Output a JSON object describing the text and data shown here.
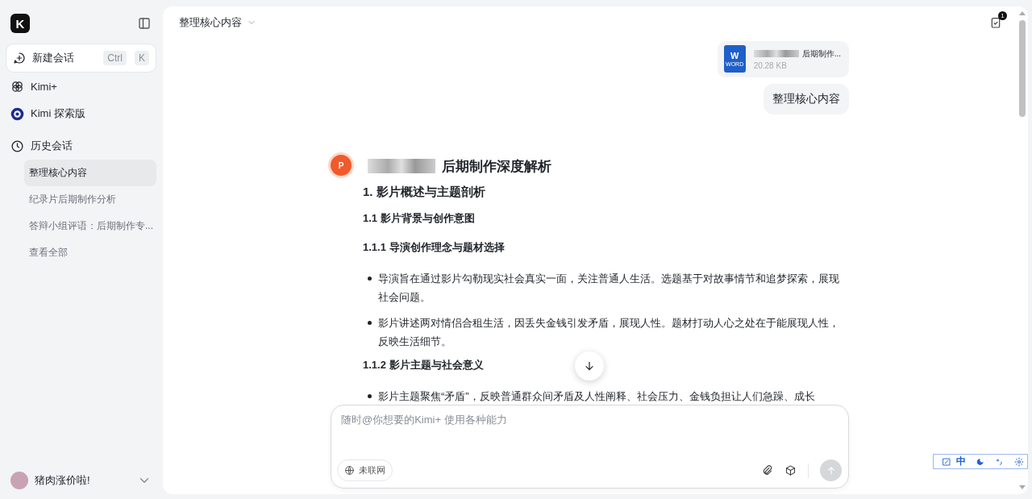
{
  "sidebar": {
    "logo": "K",
    "new_chat": {
      "label": "新建会话",
      "shortcut": [
        "Ctrl",
        "K"
      ]
    },
    "nav": [
      {
        "label": "Kimi+",
        "kind": "kimiplus"
      },
      {
        "label": "Kimi 探索版",
        "kind": "explore"
      }
    ],
    "history": {
      "label": "历史会话",
      "items": [
        {
          "label": "整理核心内容",
          "selected": true
        },
        {
          "label": "纪录片后期制作分析",
          "selected": false
        },
        {
          "label": "答辩小组评语：后期制作专...",
          "selected": false
        }
      ],
      "view_all": "查看全部"
    },
    "user": {
      "name": "猪肉涨价啦!"
    }
  },
  "header": {
    "title": "整理核心内容",
    "badge": "1"
  },
  "messages": [
    {
      "kind": "file",
      "icon_letter": "W",
      "icon_label": "WORD",
      "name": "后期制作...",
      "size": "20.28 KB"
    },
    {
      "kind": "user",
      "text": "整理核心内容"
    },
    {
      "kind": "assistant",
      "avatar_letter": "P",
      "title": "后期制作深度解析",
      "blocks": [
        {
          "kind": "h1",
          "text": "1. 影片概述与主题剖析"
        },
        {
          "kind": "h2",
          "text": "1.1 影片背景与创作意图"
        },
        {
          "kind": "h3",
          "text": "1.1.1 导演创作理念与题材选择"
        },
        {
          "kind": "bullet",
          "text": "导演旨在通过影片勾勒现实社会真实一面，关注普通人生活。选题基于对故事情节和追梦探索，展现社会问题。"
        },
        {
          "kind": "bullet",
          "text": "影片讲述两对情侣合租生活，因丢失金钱引发矛盾，展现人性。题材打动人心之处在于能展现人性，反映生活细节。"
        },
        {
          "kind": "h3",
          "text": "1.1.2 影片主题与社会意义"
        },
        {
          "kind": "bullet",
          "text": "影片主题聚焦“矛盾”，反映普通群众间矛盾及人性阐释、社会压力、金钱负担让人们急躁、成长"
        }
      ]
    }
  ],
  "composer": {
    "placeholder": "随时@你想要的Kimi+ 使用各种能力",
    "web": {
      "label": "未联网",
      "on": false
    }
  },
  "ime": {
    "mode": "中"
  }
}
